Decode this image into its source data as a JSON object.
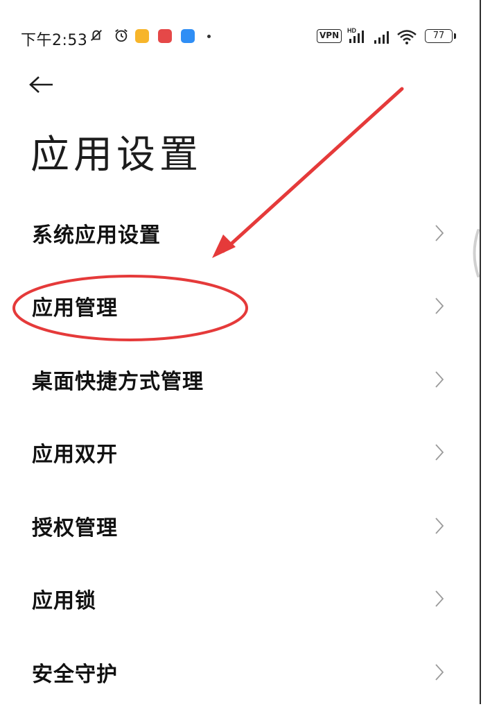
{
  "status_bar": {
    "time": "下午2:53",
    "vpn_label": "VPN",
    "hd_label": "HD",
    "battery_level": "77",
    "icons": [
      "mute-icon",
      "alarm-icon",
      "message-notification-icon",
      "app-notification-red-icon",
      "app-notification-blue-icon",
      "vpn-icon",
      "signal-icon",
      "wifi-icon",
      "battery-icon"
    ]
  },
  "header": {
    "back_icon": "arrow-left-icon",
    "title": "应用设置"
  },
  "settings": {
    "items": [
      {
        "label": "系统应用设置"
      },
      {
        "label": "应用管理"
      },
      {
        "label": "桌面快捷方式管理"
      },
      {
        "label": "应用双开"
      },
      {
        "label": "授权管理"
      },
      {
        "label": "应用锁"
      },
      {
        "label": "安全守护"
      }
    ]
  },
  "annotation": {
    "color": "#e53a3a",
    "highlighted_item": "应用管理"
  },
  "colors": {
    "background": "#ffffff",
    "text": "#111111",
    "chevron": "#9a9a9a",
    "annotation": "#e53a3a"
  }
}
